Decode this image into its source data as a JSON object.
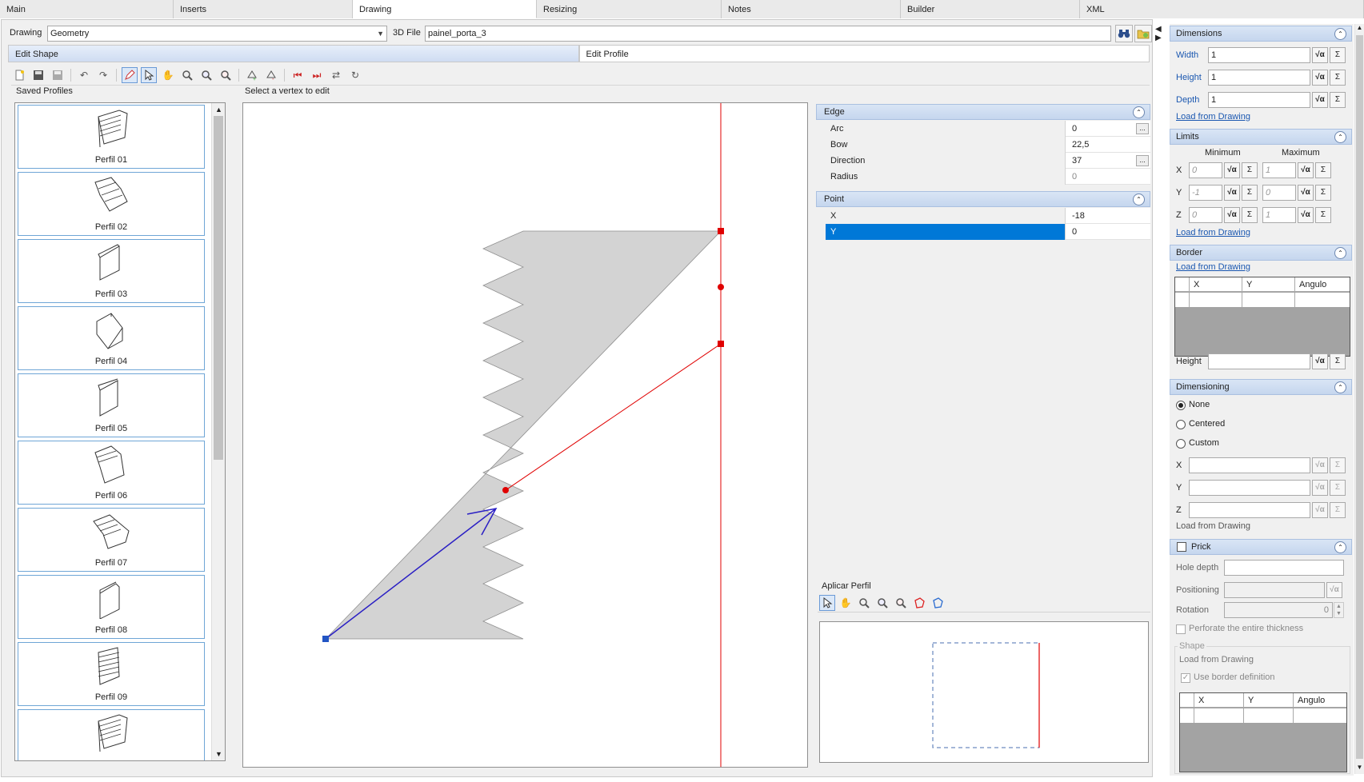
{
  "top_tabs": [
    {
      "label": "Main"
    },
    {
      "label": "Inserts"
    },
    {
      "label": "Drawing"
    },
    {
      "label": "Resizing"
    },
    {
      "label": "Notes"
    },
    {
      "label": "Builder"
    },
    {
      "label": "XML"
    }
  ],
  "drawing_row": {
    "drawing_label": "Drawing",
    "drawing_value": "Geometry",
    "file_label": "3D File",
    "file_value": "painel_porta_3"
  },
  "sub_tabs": [
    {
      "label": "Edit Shape"
    },
    {
      "label": "Edit Profile"
    }
  ],
  "saved_profiles_label": "Saved Profiles",
  "status_hint": "Select a vertex to edit",
  "profiles": [
    {
      "name": "Perfil 01"
    },
    {
      "name": "Perfil 02"
    },
    {
      "name": "Perfil 03"
    },
    {
      "name": "Perfil 04"
    },
    {
      "name": "Perfil 05"
    },
    {
      "name": "Perfil 06"
    },
    {
      "name": "Perfil 07"
    },
    {
      "name": "Perfil 08"
    },
    {
      "name": "Perfil 09"
    },
    {
      "name": ""
    }
  ],
  "property_grid": {
    "edge": {
      "title": "Edge",
      "rows": [
        {
          "key": "Arc",
          "value": "0"
        },
        {
          "key": "Bow",
          "value": "22,5"
        },
        {
          "key": "Direction",
          "value": "37"
        },
        {
          "key": "Radius",
          "value": "0"
        }
      ]
    },
    "point": {
      "title": "Point",
      "rows": [
        {
          "key": "X",
          "value": "-18"
        },
        {
          "key": "Y",
          "value": "0"
        }
      ]
    }
  },
  "aplicar_perfil_label": "Aplicar Perfil",
  "right_panel": {
    "dimensions": {
      "title": "Dimensions",
      "width_label": "Width",
      "width_value": "1",
      "height_label": "Height",
      "height_value": "1",
      "depth_label": "Depth",
      "depth_value": "1",
      "load_link": "Load from Drawing"
    },
    "limits": {
      "title": "Limits",
      "min_label": "Minimum",
      "max_label": "Maximum",
      "x_label": "X",
      "x_min": "0",
      "x_max": "1",
      "y_label": "Y",
      "y_min": "-1",
      "y_max": "0",
      "z_label": "Z",
      "z_min": "0",
      "z_max": "1",
      "load_link": "Load from Drawing"
    },
    "border": {
      "title": "Border",
      "load_link": "Load from Drawing",
      "columns": [
        "X",
        "Y",
        "Angulo"
      ],
      "height_label": "Height"
    },
    "dimensioning": {
      "title": "Dimensioning",
      "options": [
        "None",
        "Centered",
        "Custom"
      ],
      "x_label": "X",
      "y_label": "Y",
      "z_label": "Z",
      "load_text": "Load from Drawing"
    },
    "prick": {
      "title": "Prick",
      "hole_depth_label": "Hole depth",
      "positioning_label": "Positioning",
      "rotation_label": "Rotation",
      "rotation_value": "0",
      "perforate_label": "Perforate the entire thickness",
      "shape_label": "Shape",
      "shape_load_text": "Load from Drawing",
      "use_border_label": "Use border definition",
      "columns": [
        "X",
        "Y",
        "Angulo"
      ]
    }
  },
  "icons": {
    "fx": "√α",
    "sigma": "Σ",
    "collapse": "⌃"
  },
  "colors": {
    "accent": "#0078d7",
    "section_header": "#c5d6ee",
    "link": "#1a57b0",
    "shape_fill": "#d3d3d3",
    "edit_line": "#e00000",
    "direction_arrow": "#2a1fc4",
    "vertex_blue": "#2255c4"
  }
}
